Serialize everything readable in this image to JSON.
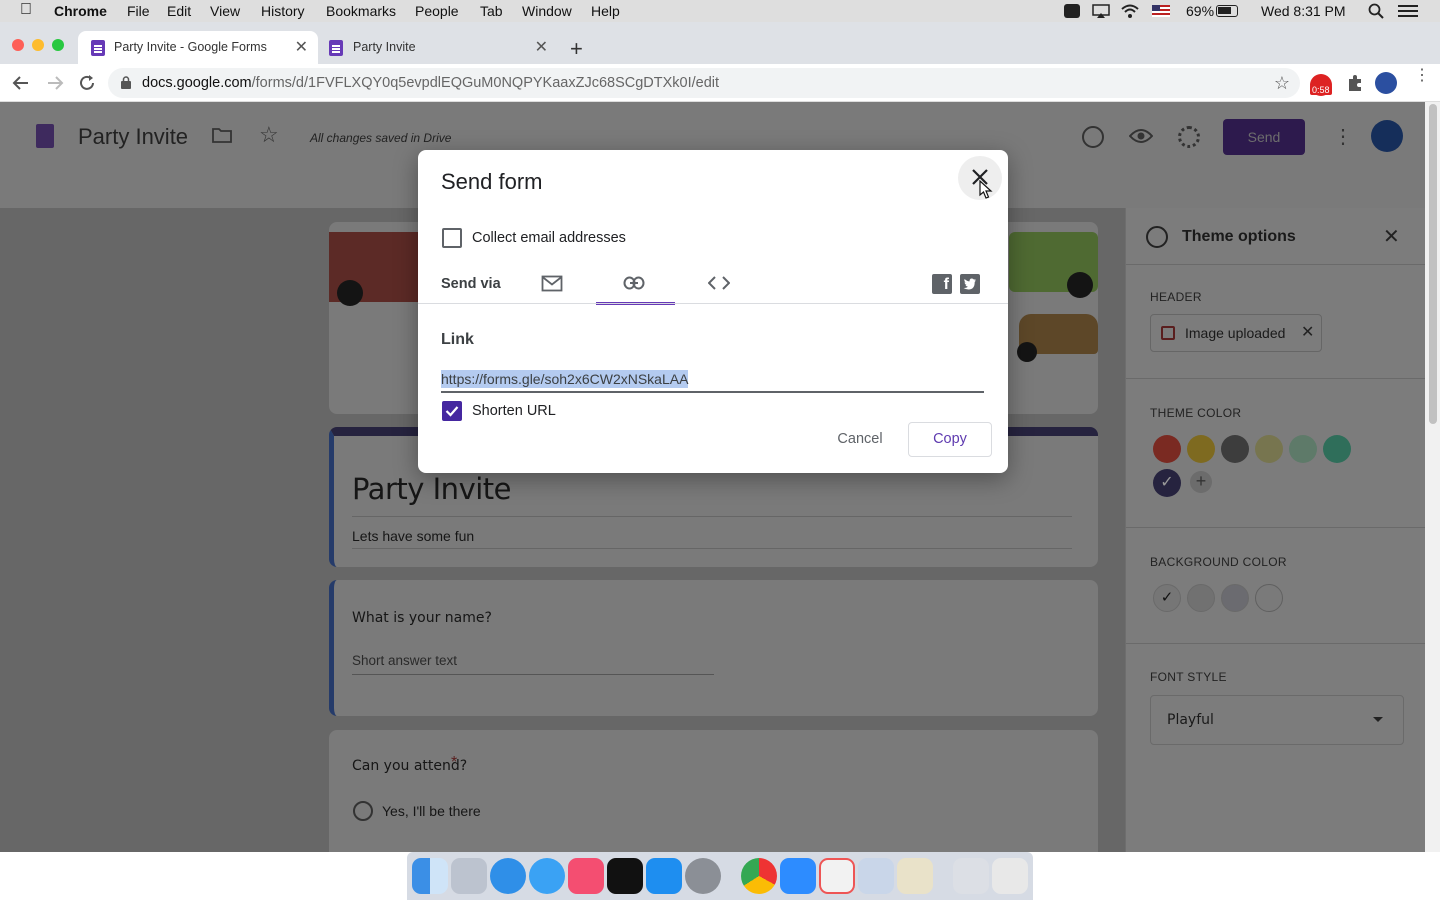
{
  "menubar": {
    "app": "Chrome",
    "items": [
      "File",
      "Edit",
      "View",
      "History",
      "Bookmarks",
      "People",
      "Tab",
      "Window",
      "Help"
    ],
    "battery": "69%",
    "clock": "Wed 8:31 PM"
  },
  "tabs": [
    {
      "title": "Party Invite - Google Forms"
    },
    {
      "title": "Party Invite"
    }
  ],
  "toolbar": {
    "url_host": "docs.google.com",
    "url_path": "/forms/d/1FVFLXQY0q5evpdlEQGuM0NQPYKaaxZJc68SCgDTXk0I/edit",
    "ext_badge": "0:58"
  },
  "app_header": {
    "form_title": "Party Invite",
    "save_status": "All changes saved in Drive",
    "send_label": "Send"
  },
  "form": {
    "title": "Party Invite",
    "description": "Lets have some fun",
    "q1": {
      "title": "What is your name?",
      "placeholder": "Short answer text"
    },
    "q2": {
      "title": "Can you attend?",
      "required": "*",
      "option1": "Yes,  I'll be there"
    }
  },
  "theme": {
    "title": "Theme options",
    "header_label": "HEADER",
    "image_chip": "Image uploaded",
    "color_label": "THEME COLOR",
    "colors": [
      "#7a2a22",
      "#7e6a20",
      "#3d3d3d",
      "#77754f",
      "#5e7a69",
      "#2f6e5a",
      "#26233f"
    ],
    "bg_label": "BACKGROUND COLOR",
    "bg_colors": [
      "#767676",
      "#717171",
      "#6b6b70",
      "#7a7a7a"
    ],
    "font_label": "FONT STYLE",
    "font_value": "Playful"
  },
  "dialog": {
    "title": "Send form",
    "collect_email": "Collect email addresses",
    "send_via": "Send via",
    "link_heading": "Link",
    "link_url": "https://forms.gle/soh2x6CW2xNSkaLAA",
    "shorten": "Shorten URL",
    "cancel": "Cancel",
    "copy": "Copy"
  },
  "colors": {
    "accent": "#673ab7",
    "check": "#4527a0",
    "link_highlight": "#b4cbf0"
  }
}
